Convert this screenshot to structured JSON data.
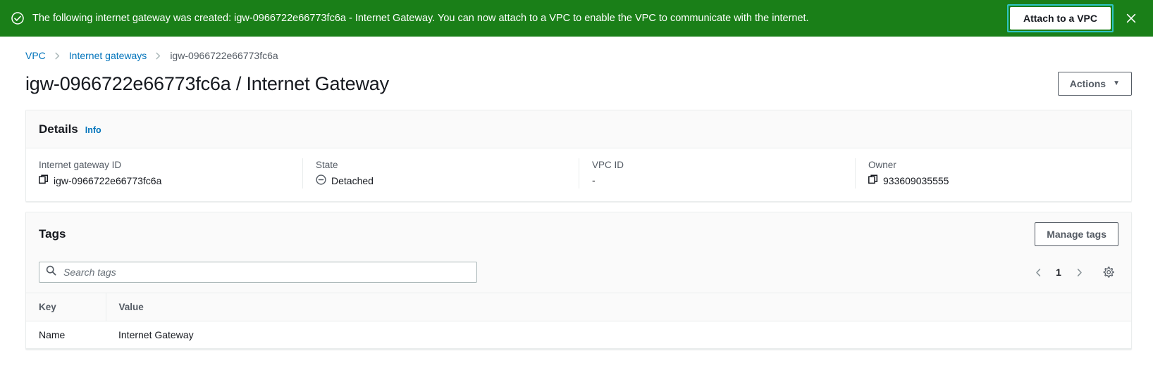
{
  "flash": {
    "icon": "check-circle-icon",
    "message": "The following internet gateway was created: igw-0966722e66773fc6a - Internet Gateway. You can now attach to a VPC to enable the VPC to communicate with the internet.",
    "action_label": "Attach to a VPC",
    "close_icon": "close-icon",
    "background_color": "#1a7f18",
    "focus_ring_color": "#2ec4c4"
  },
  "breadcrumb": {
    "items": [
      {
        "label": "VPC",
        "current": false
      },
      {
        "label": "Internet gateways",
        "current": false
      },
      {
        "label": "igw-0966722e66773fc6a",
        "current": true
      }
    ],
    "separator_icon": "chevron-right-icon",
    "link_color": "#0073bb"
  },
  "header": {
    "title": "igw-0966722e66773fc6a / Internet Gateway",
    "actions_label": "Actions",
    "actions_caret": "▼"
  },
  "details": {
    "title": "Details",
    "info_label": "Info",
    "fields": [
      {
        "label": "Internet gateway ID",
        "value": "igw-0966722e66773fc6a",
        "icon": "copy-icon"
      },
      {
        "label": "State",
        "value": "Detached",
        "icon": "circle-minus-icon"
      },
      {
        "label": "VPC ID",
        "value": "-",
        "icon": ""
      },
      {
        "label": "Owner",
        "value": "933609035555",
        "icon": "copy-icon"
      }
    ]
  },
  "tags": {
    "title": "Tags",
    "manage_label": "Manage tags",
    "search": {
      "placeholder": "Search tags",
      "value": "",
      "icon": "search-icon"
    },
    "pagination": {
      "prev_icon": "chevron-left-icon",
      "page": "1",
      "next_icon": "chevron-right-icon",
      "settings_icon": "gear-icon"
    },
    "columns": [
      "Key",
      "Value"
    ],
    "rows": [
      {
        "key": "Name",
        "value": "Internet Gateway"
      }
    ]
  }
}
